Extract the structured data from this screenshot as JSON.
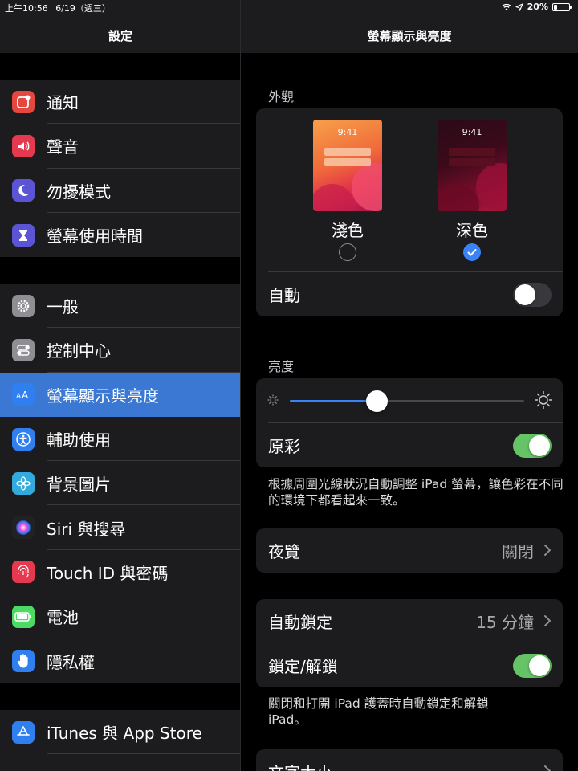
{
  "status_bar": {
    "time": "上午10:56",
    "date": "6/19（週三）",
    "battery": "20%",
    "battery_level": 0.2
  },
  "sidebar": {
    "title": "設定",
    "groups": [
      {
        "items": [
          {
            "label": "通知",
            "icon": "notifications-icon",
            "color": "#e5463d"
          },
          {
            "label": "聲音",
            "icon": "sounds-icon",
            "color": "#e5394f"
          },
          {
            "label": "勿擾模式",
            "icon": "do-not-disturb-icon",
            "color": "#5b55d6"
          },
          {
            "label": "螢幕使用時間",
            "icon": "screen-time-icon",
            "color": "#5b55d6"
          }
        ]
      },
      {
        "items": [
          {
            "label": "一般",
            "icon": "general-gear-icon",
            "color": "#8e8e93"
          },
          {
            "label": "控制中心",
            "icon": "control-center-icon",
            "color": "#8e8e93"
          },
          {
            "label": "螢幕顯示與亮度",
            "icon": "display-brightness-icon",
            "color": "#2f7ff0",
            "selected": true
          },
          {
            "label": "輔助使用",
            "icon": "accessibility-icon",
            "color": "#2f7ff0"
          },
          {
            "label": "背景圖片",
            "icon": "wallpaper-icon",
            "color": "#34aadc"
          },
          {
            "label": "Siri 與搜尋",
            "icon": "siri-icon",
            "color": "#222222"
          },
          {
            "label": "Touch ID 與密碼",
            "icon": "touch-id-icon",
            "color": "#e5394f"
          },
          {
            "label": "電池",
            "icon": "battery-icon",
            "color": "#4cd964"
          },
          {
            "label": "隱私權",
            "icon": "privacy-hand-icon",
            "color": "#2f7ff0"
          }
        ]
      },
      {
        "items": [
          {
            "label": "iTunes 與 App Store",
            "icon": "app-store-icon",
            "color": "#2f7ff0"
          }
        ]
      }
    ]
  },
  "main": {
    "title": "螢幕顯示與亮度",
    "appearance": {
      "section_label": "外觀",
      "light": {
        "label": "淺色",
        "time": "9:41",
        "selected": false
      },
      "dark": {
        "label": "深色",
        "time": "9:41",
        "selected": true
      },
      "automatic_label": "自動",
      "automatic_on": false
    },
    "brightness": {
      "section_label": "亮度",
      "level": 0.37,
      "true_tone_label": "原彩",
      "true_tone_on": true,
      "footnote": "根據周圍光線狀況自動調整 iPad 螢幕，讓色彩在不同的環境下都看起來一致。"
    },
    "night_shift": {
      "label": "夜覽",
      "value": "關閉"
    },
    "lock": {
      "auto_lock_label": "自動鎖定",
      "auto_lock_value": "15 分鐘",
      "lock_unlock_label": "鎖定/解鎖",
      "lock_unlock_on": true,
      "footnote": "關閉和打開 iPad 護蓋時自動鎖定和解鎖 iPad。"
    },
    "text_size": {
      "label": "文字大小"
    }
  }
}
